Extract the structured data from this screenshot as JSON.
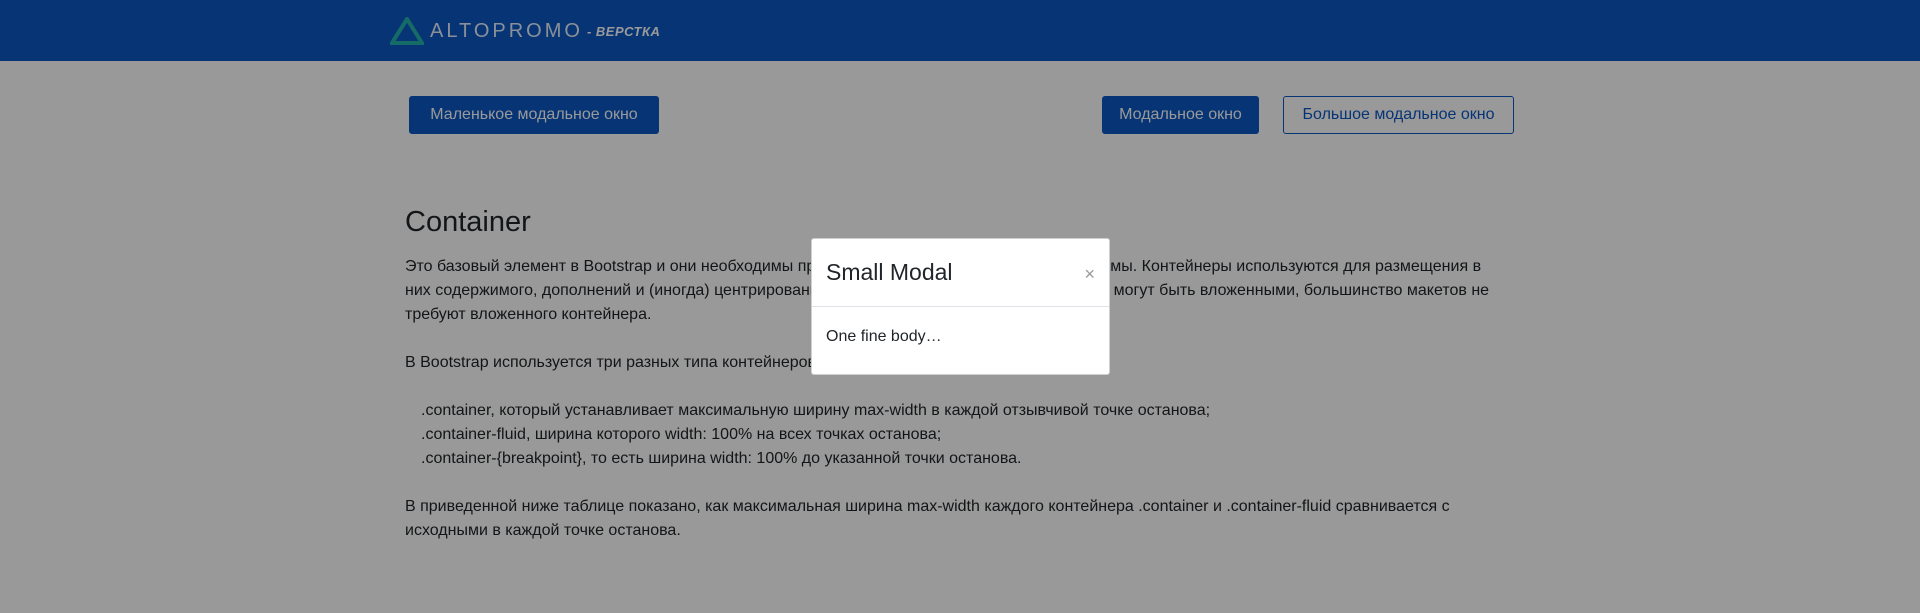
{
  "header": {
    "brand_name": "ALTOPROMO",
    "brand_sub": "- ВЕРСТКА",
    "background": "#0a58c4",
    "logo_icon": "triangle-logo-icon"
  },
  "buttons": {
    "small_modal": "Маленькое модальное окно",
    "modal": "Модальное окно",
    "large_modal": "Большое модальное окно"
  },
  "content": {
    "title": "Container",
    "paragraph1": "Это базовый элемент в Bootstrap и они необходимы при использовании нашей сеточной системы. Контейнеры используются для размещения в них содержимого, дополнений и (иногда) центрирования содержимого в них. Хотя контейнеры могут быть вложенными, большинство макетов не требуют вложенного контейнера.",
    "paragraph2": "В Bootstrap используется три разных типа контейнеров:",
    "list": [
      ".container, который устанавливает максимальную ширину max-width в каждой отзывчивой точке останова;",
      ".container-fluid, ширина которого width: 100% на всех точках останова;",
      ".container-{breakpoint}, то есть ширина width: 100% до указанной точки останова."
    ],
    "paragraph3": "В приведенной ниже таблице показано, как максимальная ширина max-width каждого контейнера .container и .container-fluid сравнивается с исходными в каждой точке останова."
  },
  "modal": {
    "title": "Small Modal",
    "close": "×",
    "body": "One fine body…"
  }
}
